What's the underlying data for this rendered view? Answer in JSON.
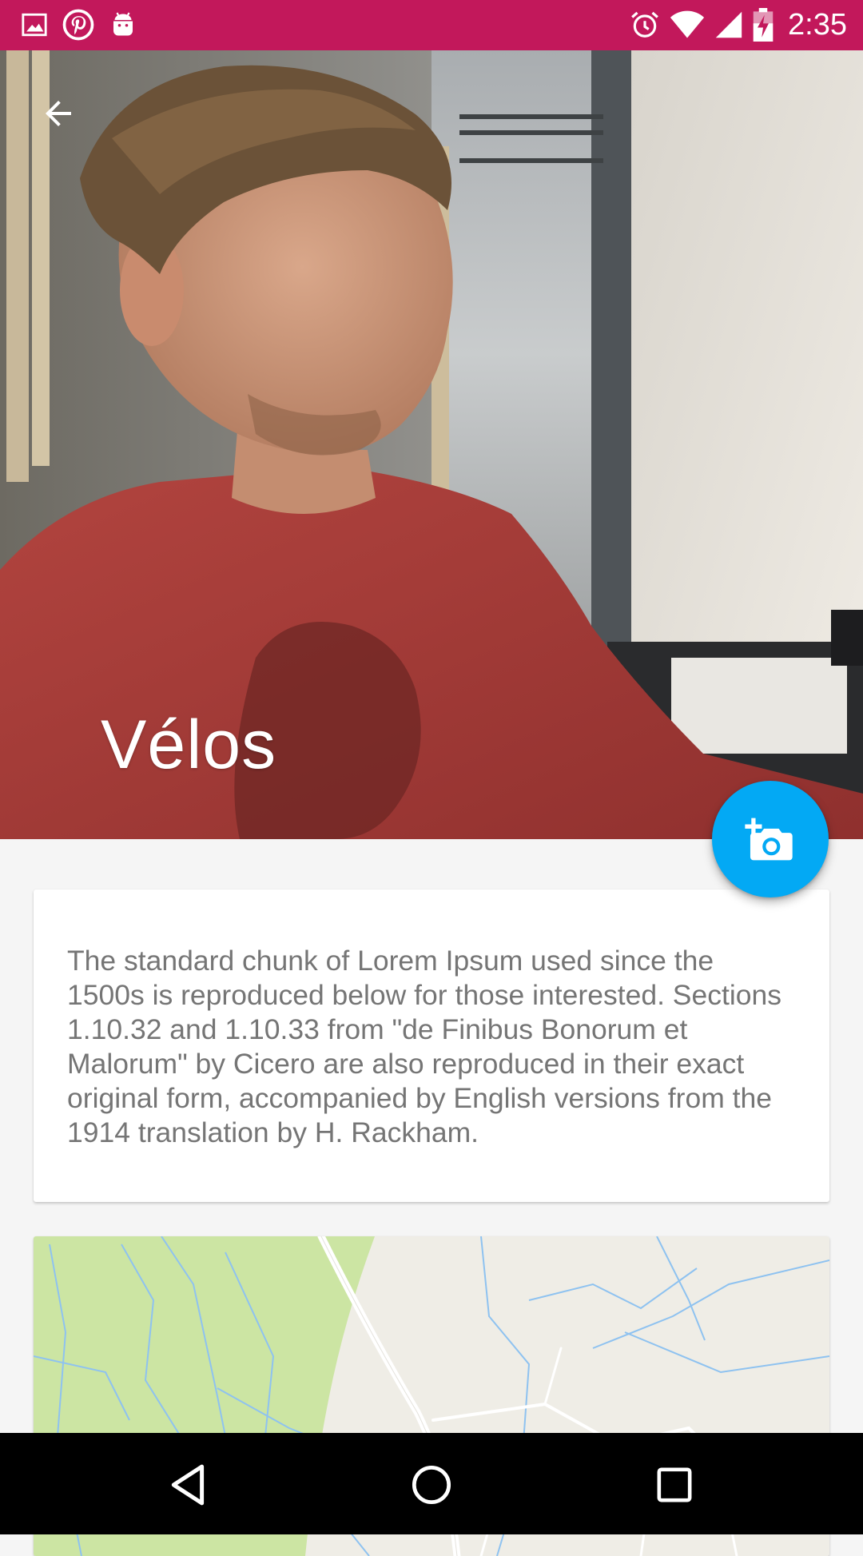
{
  "status_bar": {
    "time": "2:35",
    "left_icons": [
      "image-icon",
      "pinterest-icon",
      "android-icon"
    ],
    "right_icons": [
      "alarm-icon",
      "wifi-icon",
      "signal-icon",
      "battery-charging-icon"
    ],
    "background_color": "#c2185b"
  },
  "header": {
    "title": "Vélos",
    "back_icon": "arrow-left-icon"
  },
  "fab": {
    "icon": "add-a-photo-icon",
    "color": "#03a9f4"
  },
  "description_card": {
    "text": "The standard chunk of Lorem Ipsum used since the 1500s is reproduced below for those interested. Sections 1.10.32 and 1.10.33 from \"de Finibus Bonorum et Malorum\" by Cicero are also reproduced in their exact original form, accompanied by English versions from the 1914 translation by H. Rackham."
  },
  "map_card": {
    "colors": {
      "park": "#cce5a3",
      "land": "#efede6",
      "water_lines": "#8ec2f0",
      "roads": "#ffffff"
    }
  },
  "nav_bar": {
    "buttons": [
      "back-icon",
      "home-icon",
      "recents-icon"
    ]
  }
}
